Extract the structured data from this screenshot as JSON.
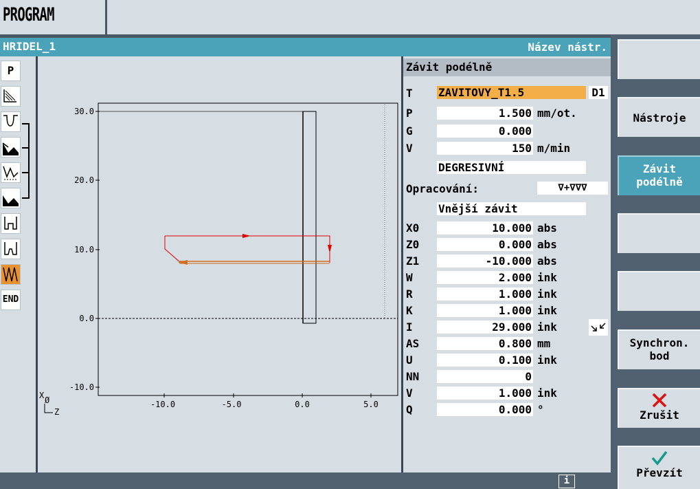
{
  "header": {
    "title": "PROGRAM"
  },
  "titlebar": {
    "program_name": "HRIDEL_1",
    "tool_name_label": "Název nástr."
  },
  "left_strip": {
    "items": [
      {
        "label": "P",
        "icon": "program-header-icon"
      },
      {
        "label": "",
        "icon": "stock-removal-icon"
      },
      {
        "label": "",
        "icon": "groove-icon"
      },
      {
        "label": "",
        "icon": "groove-residual-icon"
      },
      {
        "label": "",
        "icon": "undercut-icon"
      },
      {
        "label": "",
        "icon": "undercut-residual-icon"
      },
      {
        "label": "",
        "icon": "thread-undercut-icon"
      },
      {
        "label": "",
        "icon": "thread-undercut-2-icon"
      },
      {
        "label": "",
        "icon": "thread-icon"
      },
      {
        "label": "END",
        "icon": "end-icon"
      }
    ]
  },
  "graph": {
    "y_ticks": [
      "30.0",
      "20.0",
      "10.0",
      "0.0",
      "-10.0"
    ],
    "x_ticks": [
      "-10.0",
      "-5.0",
      "0.0",
      "5.0"
    ],
    "axis_x_label": "X",
    "axis_diam_label": "Ø",
    "axis_z_label": "Z",
    "colors": {
      "path": "#e00000",
      "thread": "#d07020"
    }
  },
  "form": {
    "title": "Závit podélně",
    "tool": {
      "label": "T",
      "value": "ZAVITOVY_T1.5",
      "d": "D1"
    },
    "rows": [
      {
        "label": "P",
        "value": "1.500",
        "unit": "mm/ot."
      },
      {
        "label": "G",
        "value": "0.000",
        "unit": ""
      },
      {
        "label": "V",
        "value": "150",
        "unit": "m/min"
      }
    ],
    "degressive": "DEGRESIVNÍ",
    "machining": {
      "label": "Opracování:",
      "value": "∇+∇∇∇"
    },
    "thread_type": "Vnější závit",
    "params": [
      {
        "label": "X0",
        "value": "10.000",
        "unit": "abs"
      },
      {
        "label": "Z0",
        "value": "0.000",
        "unit": "abs"
      },
      {
        "label": "Z1",
        "value": "-10.000",
        "unit": "abs"
      },
      {
        "label": "W",
        "value": "2.000",
        "unit": "ink"
      },
      {
        "label": "R",
        "value": "1.000",
        "unit": "ink"
      },
      {
        "label": "K",
        "value": "1.000",
        "unit": "ink"
      },
      {
        "label": "I",
        "value": "29.000",
        "unit": "ink"
      },
      {
        "label": "AS",
        "value": "0.800",
        "unit": "mm"
      },
      {
        "label": "U",
        "value": "0.100",
        "unit": "ink"
      },
      {
        "label": "NN",
        "value": "0",
        "unit": ""
      },
      {
        "label": "V",
        "value": "1.000",
        "unit": "ink"
      },
      {
        "label": "Q",
        "value": "0.000",
        "unit": "°"
      }
    ]
  },
  "softkeys": {
    "k1": "",
    "k2": "Nástroje",
    "k3_line1": "Závit",
    "k3_line2": "podélně",
    "k4": "",
    "k5": "",
    "k6_line1": "Synchron.",
    "k6_line2": "bod",
    "k7": "Zrušit",
    "k8": "Převzít"
  },
  "status": {
    "info": "i"
  }
}
